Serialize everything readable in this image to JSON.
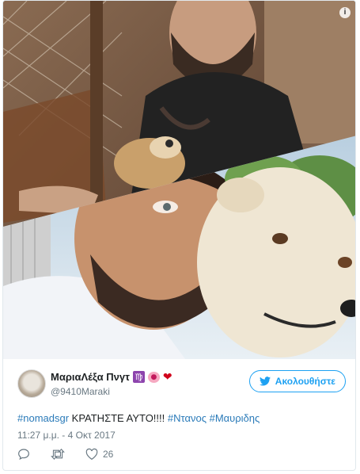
{
  "tweet": {
    "author": {
      "display_name": "ΜαριαΛέξα Πνγτ",
      "name_emojis": [
        "♍",
        "🐷",
        "❤"
      ],
      "handle": "@9410Maraki",
      "avatar_icon": "avatar-photo"
    },
    "follow_label": "Ακολουθήστε",
    "text": {
      "hashtag_1": "#nomadsgr",
      "plain": " ΚΡΑΤΗΣΤΕ ΑΥΤΟ!!!! ",
      "hashtag_2": "#Ντανος",
      "space": " ",
      "hashtag_3": "#Μαυριδης"
    },
    "timestamp": "11:27 μ.μ. - 4 Οκτ 2017",
    "actions": {
      "reply_icon": "reply-icon",
      "retweet_icon": "retweet-icon",
      "like_icon": "heart-icon",
      "like_count": "26"
    },
    "info_icon": "i",
    "colors": {
      "link": "#2b7bb9",
      "accent": "#1da1f2",
      "muted": "#697882"
    }
  }
}
